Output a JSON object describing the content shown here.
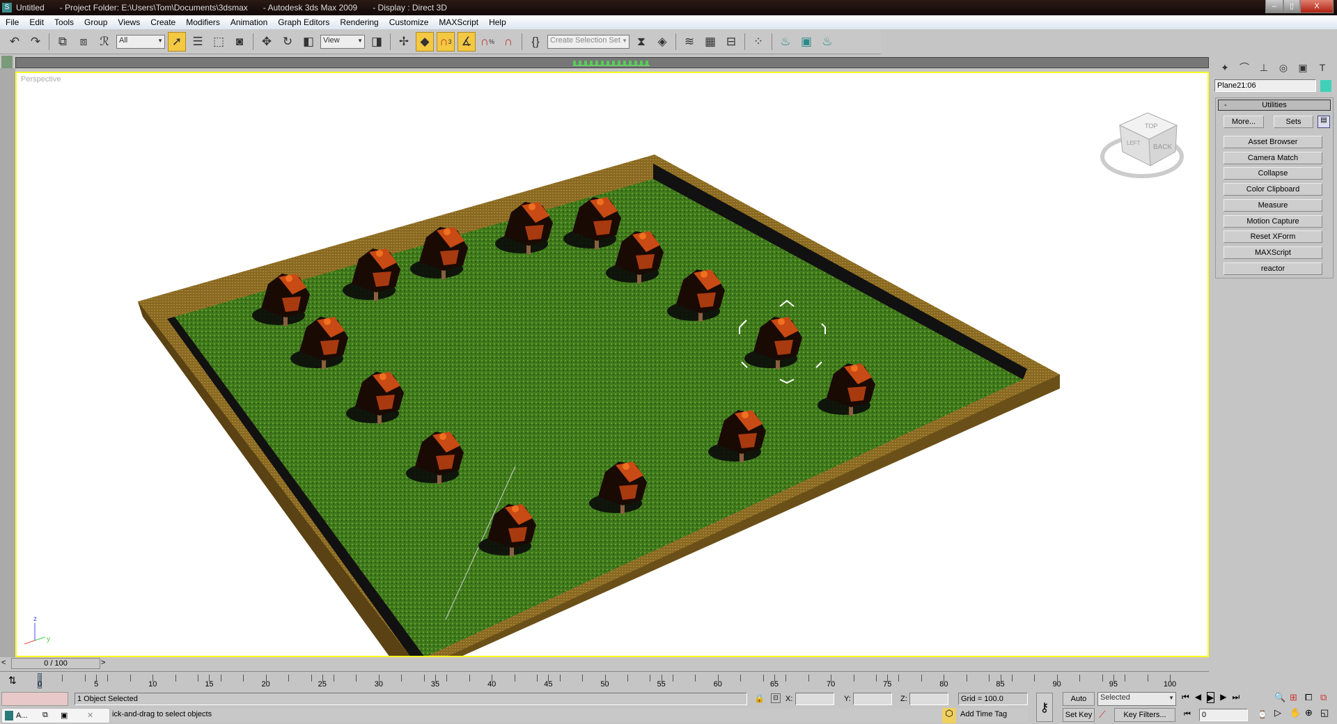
{
  "window": {
    "title": "Untitled",
    "project": "- Project Folder: E:\\Users\\Tom\\Documents\\3dsmax",
    "app": "- Autodesk 3ds Max  2009",
    "display": "- Display : Direct 3D",
    "minimize": "–",
    "restore": "▯",
    "close": "X"
  },
  "menu": [
    "File",
    "Edit",
    "Tools",
    "Group",
    "Views",
    "Create",
    "Modifiers",
    "Animation",
    "Graph Editors",
    "Rendering",
    "Customize",
    "MAXScript",
    "Help"
  ],
  "toolbar": {
    "selection_filter": "All",
    "reference_coord": "View",
    "named_selection_placeholder": "Create Selection Set",
    "snap_badge": "3",
    "percent_badge": "%"
  },
  "viewport": {
    "label": "Perspective",
    "viewcube_top": "TOP",
    "viewcube_back": "BACK",
    "viewcube_left": "LEFT",
    "axis_z": "z",
    "axis_y": "y",
    "axis_x": "x"
  },
  "panel": {
    "object_name": "Plane21:06",
    "object_color": "#40d0b8",
    "rollout_toggle": "-",
    "rollout_title": "Utilities",
    "more": "More...",
    "sets": "Sets",
    "utilities": [
      "Asset Browser",
      "Camera Match",
      "Collapse",
      "Color Clipboard",
      "Measure",
      "Motion Capture",
      "Reset XForm",
      "MAXScript",
      "reactor"
    ]
  },
  "timeline": {
    "frame_display": "0 / 100",
    "prev": "<",
    "next": ">",
    "ticks": [
      "0",
      "5",
      "10",
      "15",
      "20",
      "25",
      "30",
      "35",
      "40",
      "45",
      "50",
      "55",
      "60",
      "65",
      "70",
      "75",
      "80",
      "85",
      "90",
      "95",
      "100"
    ]
  },
  "status": {
    "selection": "1 Object Selected",
    "prompt": "ick-and-drag to select objects",
    "x_label": "X:",
    "y_label": "Y:",
    "z_label": "Z:",
    "x_value": "",
    "y_value": "",
    "z_value": "",
    "grid": "Grid = 100.0",
    "add_time_tag": "Add Time Tag",
    "auto_key": "Auto Key",
    "set_key": "Set Key",
    "key_mode": "Selected",
    "key_filters": "Key Filters...",
    "current_frame": "0"
  },
  "taskbar": {
    "label": "A..."
  }
}
